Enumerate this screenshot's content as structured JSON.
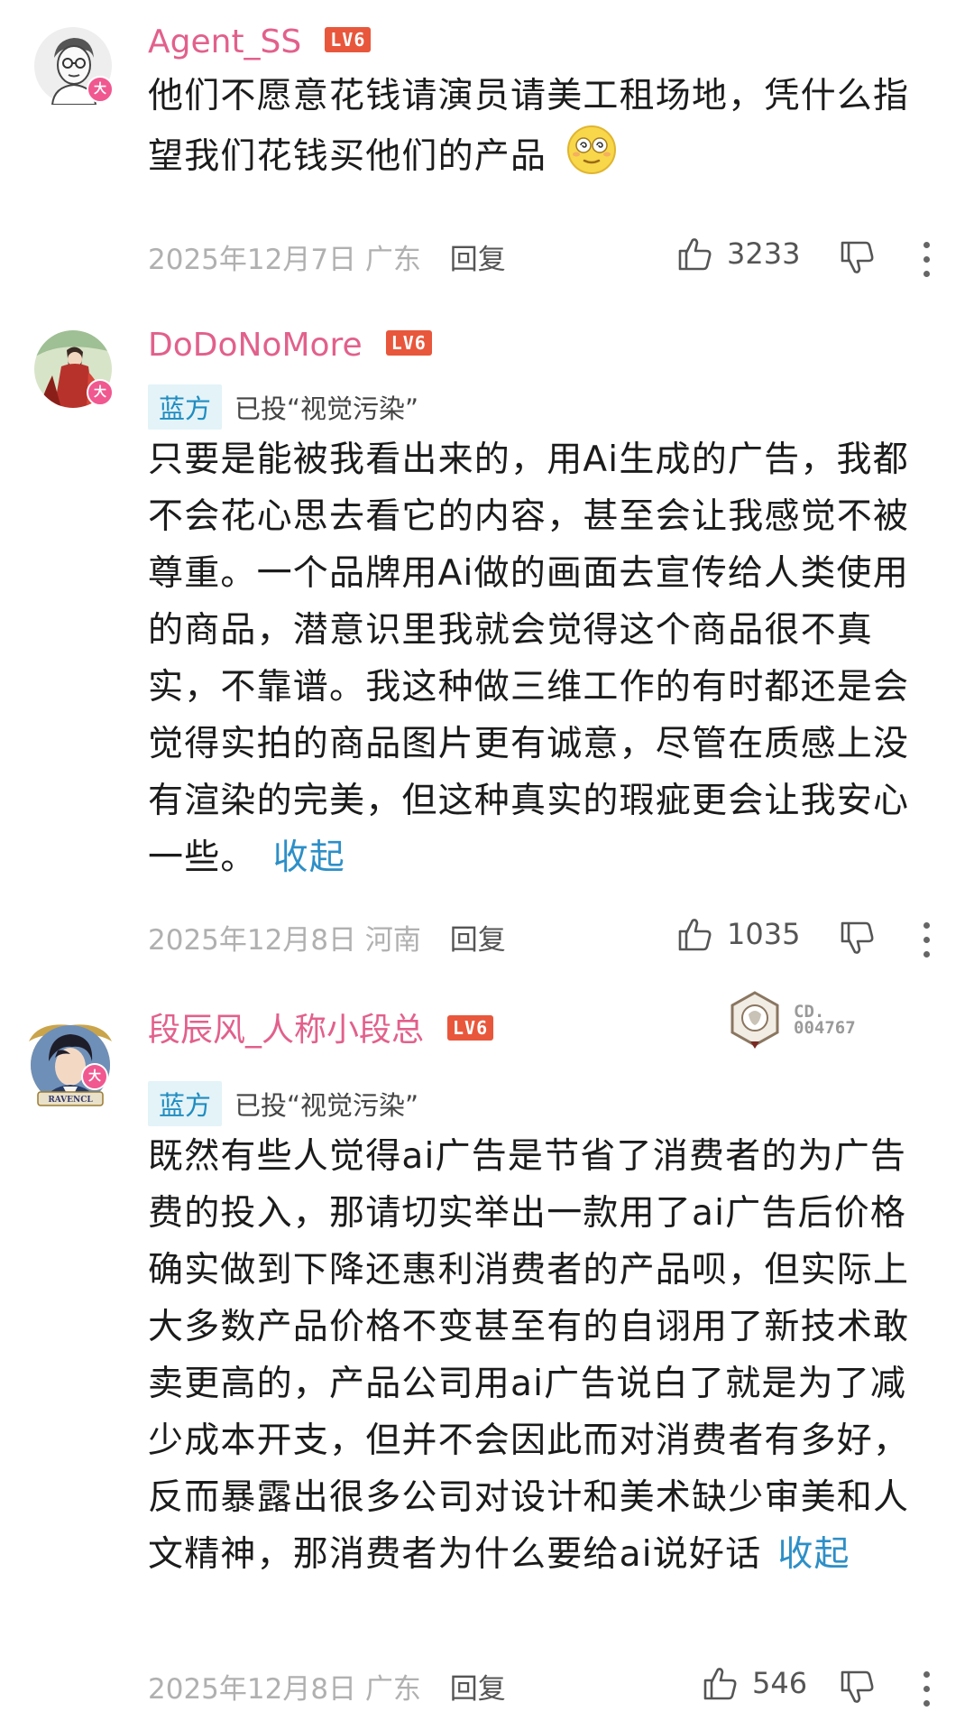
{
  "comments": [
    {
      "username": "Agent_SS",
      "level": "LV6",
      "text": "他们不愿意花钱请演员请美工租场地，凭什么指望我们花钱买他们的产品",
      "emoji": "emoji-dizzy",
      "date": "2025年12月7日",
      "location": "广东",
      "reply_label": "回复",
      "likes": "3233",
      "vip_badge": "大"
    },
    {
      "username": "DoDoNoMore",
      "level": "LV6",
      "side": "蓝方",
      "vote_text": "已投“视觉污染”",
      "text": "只要是能被我看出来的，用Ai生成的广告，我都不会花心思去看它的内容，甚至会让我感觉不被尊重。一个品牌用Ai做的画面去宣传给人类使用的商品，潜意识里我就会觉得这个商品很不真实，不靠谱。我这种做三维工作的有时都还是会觉得实拍的商品图片更有诚意，尽管在质感上没有渲染的完美，但这种真实的瑕疵更会让我安心一些。",
      "collapse": "收起",
      "date": "2025年12月8日",
      "location": "河南",
      "reply_label": "回复",
      "likes": "1035",
      "vip_badge": "大"
    },
    {
      "username": "段辰风_人称小段总",
      "level": "LV6",
      "side": "蓝方",
      "vote_text": "已投“视觉污染”",
      "text": "既然有些人觉得ai广告是节省了消费者的为广告费的投入，那请切实举出一款用了ai广告后价格确实做到下降还惠利消费者的产品呗，但实际上大多数产品价格不变甚至有的自诩用了新技术敢卖更高的，产品公司用ai广告说白了就是为了减少成本开支，但并不会因此而对消费者有多好，反而暴露出很多公司对设计和美术缺少审美和人文精神，那消费者为什么要给ai说好话",
      "collapse": "收起",
      "date": "2025年12月8日",
      "location": "广东",
      "reply_label": "回复",
      "likes": "546",
      "vip_badge": "大",
      "avatar_text": "RAVENCL",
      "card_line1": "CD.",
      "card_line2": "004767"
    }
  ],
  "colors": {
    "username": "#e2608c",
    "level_badge": "#e8573c",
    "side_tag_bg": "#e3f3f8",
    "side_tag_text": "#1f8cc0",
    "collapse_link": "#2d8fc7",
    "meta_text": "#b0b0b0"
  }
}
